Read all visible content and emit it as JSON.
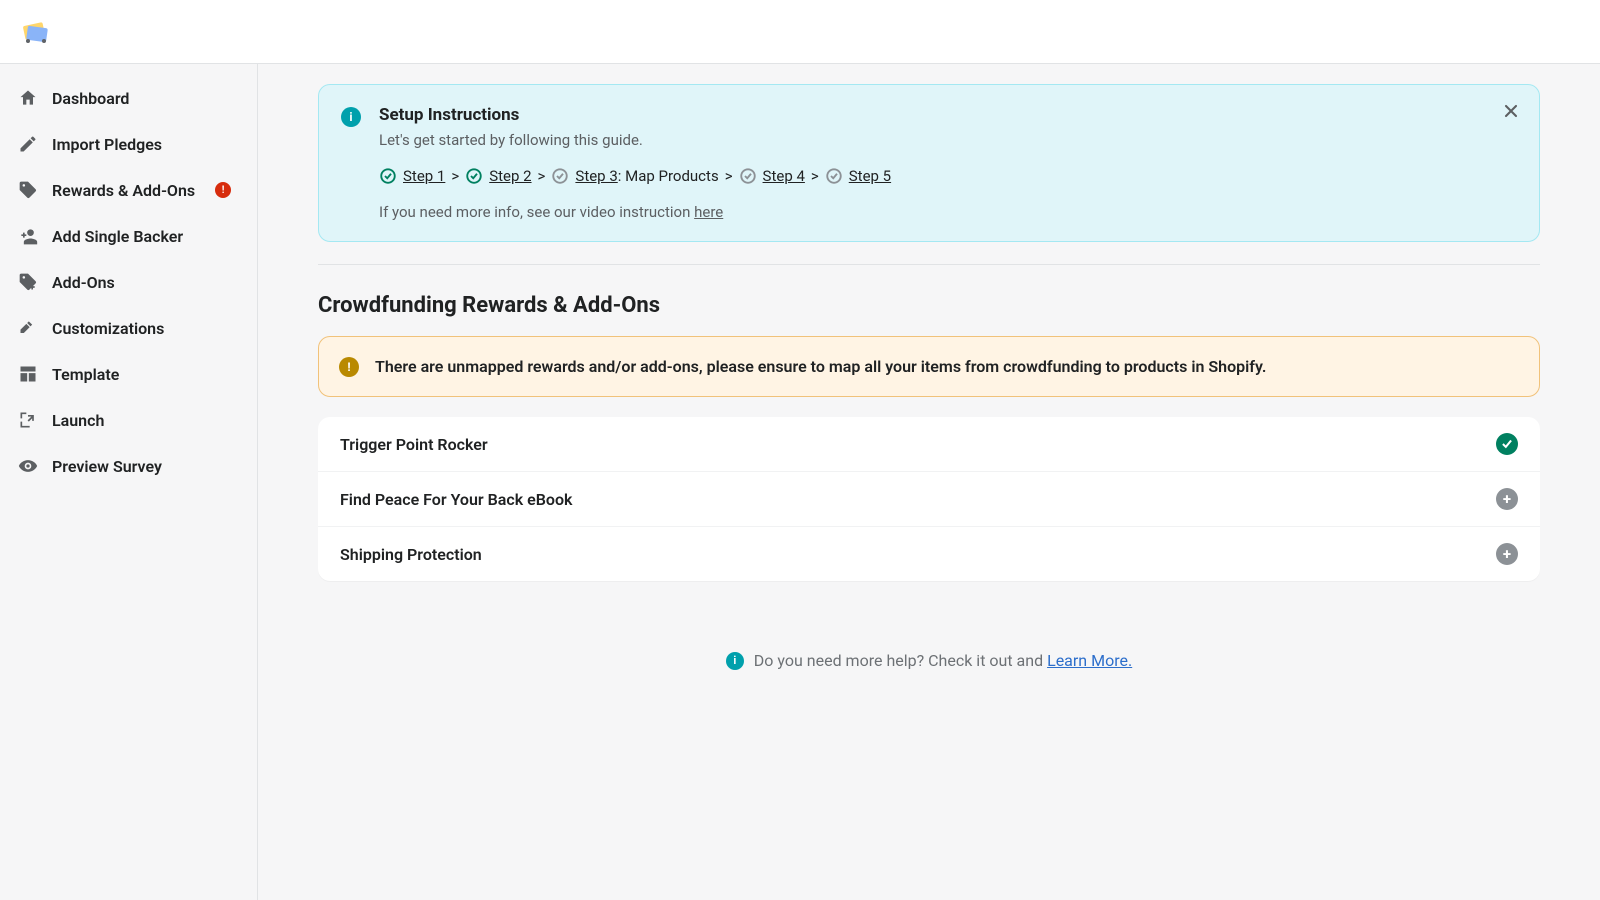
{
  "sidebar": {
    "items": [
      {
        "label": "Dashboard",
        "icon": "home"
      },
      {
        "label": "Import Pledges",
        "icon": "edit"
      },
      {
        "label": "Rewards & Add-Ons",
        "icon": "tag",
        "alert": true
      },
      {
        "label": "Add Single Backer",
        "icon": "person-add"
      },
      {
        "label": "Add-Ons",
        "icon": "tag-plus"
      },
      {
        "label": "Customizations",
        "icon": "hammer"
      },
      {
        "label": "Template",
        "icon": "layout"
      },
      {
        "label": "Launch",
        "icon": "launch"
      },
      {
        "label": "Preview Survey",
        "icon": "eye"
      }
    ]
  },
  "banner": {
    "title": "Setup Instructions",
    "subtitle": "Let's get started by following this guide.",
    "steps": [
      {
        "label": "Step 1",
        "done": true
      },
      {
        "label": "Step 2",
        "done": true
      },
      {
        "label": "Step 3",
        "done": false,
        "suffix": ": Map Products"
      },
      {
        "label": "Step 4",
        "done": false
      },
      {
        "label": "Step 5",
        "done": false
      }
    ],
    "video_prefix": "If you need more info, see our video instruction ",
    "video_link": "here"
  },
  "section": {
    "title": "Crowdfunding Rewards & Add-Ons"
  },
  "warning": {
    "text": "There are unmapped rewards and/or add-ons, please ensure to map all your items from crowdfunding to products in Shopify."
  },
  "items": [
    {
      "name": "Trigger Point Rocker",
      "status": "ok"
    },
    {
      "name": "Find Peace For Your Back eBook",
      "status": "add"
    },
    {
      "name": "Shipping Protection",
      "status": "add"
    }
  ],
  "help": {
    "text": "Do you need more help? Check it out and ",
    "link": "Learn More."
  }
}
